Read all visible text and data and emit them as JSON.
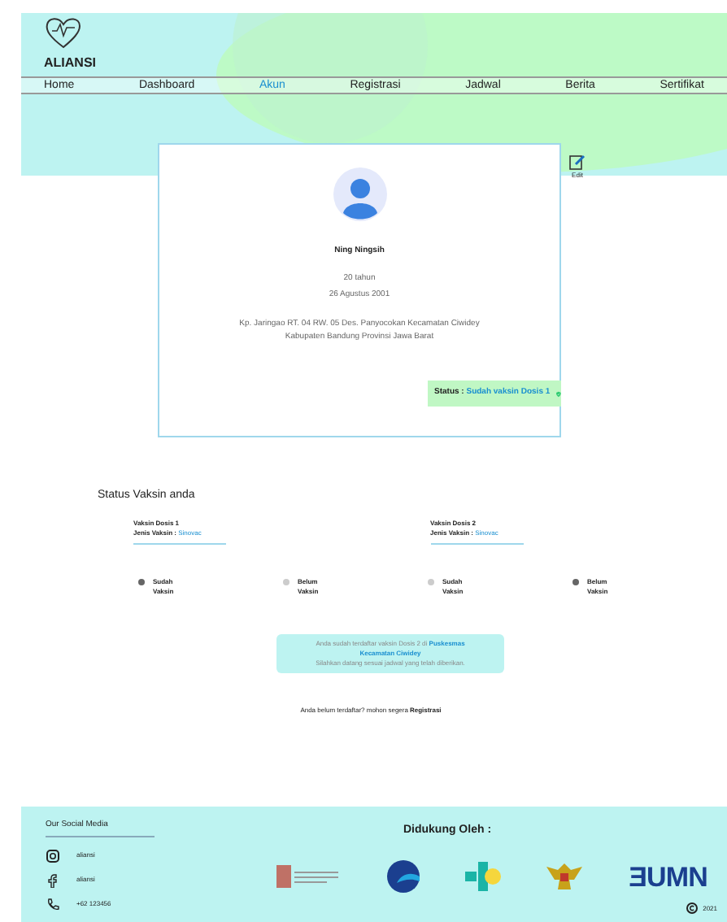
{
  "brand": {
    "name": "ALIANSI"
  },
  "nav": [
    {
      "label": "Home",
      "selected": false
    },
    {
      "label": "Dashboard",
      "selected": false
    },
    {
      "label": "Akun",
      "selected": true
    },
    {
      "label": "Registrasi",
      "selected": false
    },
    {
      "label": "Jadwal",
      "selected": false
    },
    {
      "label": "Berita",
      "selected": false
    },
    {
      "label": "Sertifikat",
      "selected": false
    }
  ],
  "profile": {
    "edit_label": "Edit",
    "name": "Ning Ningsih",
    "age": "20 tahun",
    "birth_date": "26 Agustus 2001",
    "address": "Kp. Jaringao RT. 04 RW. 05 Des. Panyocokan Kecamatan Ciwidey Kabupaten Bandung Provinsi Jawa Barat",
    "status_label": "Status :",
    "status_value": "Sudah vaksin Dosis 1"
  },
  "vaccine_status": {
    "title": "Status Vaksin anda",
    "doses": [
      {
        "title": "Vaksin Dosis 1",
        "type_label": "Jenis Vaksin :",
        "type_value": "Sinovac",
        "options": [
          {
            "label": "Sudah Vaksin",
            "selected": true
          },
          {
            "label": "Belum Vaksin",
            "selected": false
          }
        ]
      },
      {
        "title": "Vaksin Dosis 2",
        "type_label": "Jenis Vaksin :",
        "type_value": "Sinovac",
        "options": [
          {
            "label": "Sudah Vaksin",
            "selected": false
          },
          {
            "label": "Belum Vaksin",
            "selected": true
          }
        ]
      }
    ],
    "notice": "Anda sudah terdaftar vaksin Dosis 2 di **Puskesmas Kecamatan Ciwidey**",
    "notice_line_2": "Silahkan datang sesuai jadwal yang telah diberikan.",
    "register_prompt": "Anda belum terdaftar? mohon segera",
    "register_link": "Registrasi"
  },
  "footer": {
    "social_title": "Our Social Media",
    "social": [
      {
        "kind": "instagram",
        "label": "aliansi"
      },
      {
        "kind": "facebook",
        "label": "aliansi"
      },
      {
        "kind": "phone",
        "label": "+62 123456"
      }
    ],
    "supported_title": "Didukung Oleh :",
    "bumn_logo": "ƎUMN",
    "copyright": "2021"
  }
}
